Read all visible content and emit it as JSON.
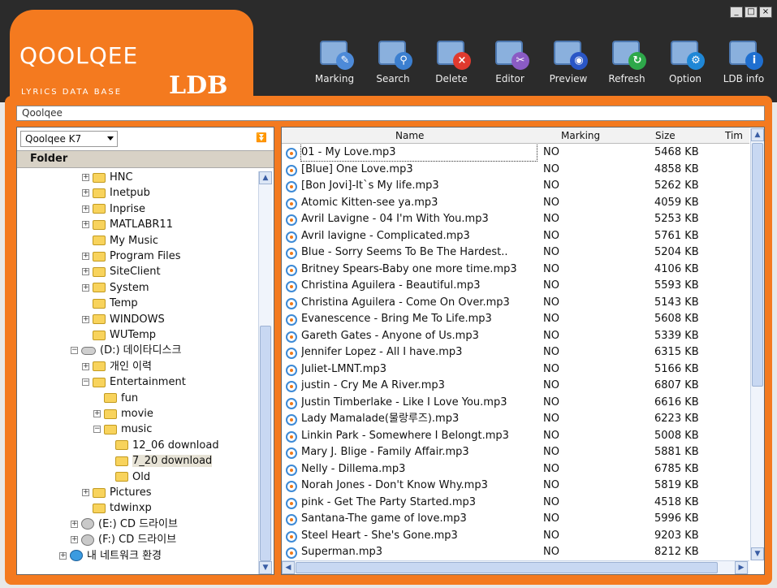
{
  "header": {
    "logo_text": "QOOLQEE",
    "logo_sub": "LYRICS DATA BASE",
    "logo_ldb": "LDB",
    "window_controls": {
      "minimize": "_",
      "maximize": "□",
      "close": "×"
    }
  },
  "toolbar": {
    "buttons": [
      {
        "label": "Marking",
        "icon": "pencil-book-icon",
        "badge": "✎",
        "badge_color": "#4d8ad8"
      },
      {
        "label": "Search",
        "icon": "magnifier-book-icon",
        "badge": "⚲",
        "badge_color": "#3b7fd0"
      },
      {
        "label": "Delete",
        "icon": "delete-book-icon",
        "badge": "×",
        "badge_color": "#e03a2e"
      },
      {
        "label": "Editor",
        "icon": "scissors-book-icon",
        "badge": "✂",
        "badge_color": "#8a5bc4"
      },
      {
        "label": "Preview",
        "icon": "eye-book-icon",
        "badge": "◉",
        "badge_color": "#2a56c6"
      },
      {
        "label": "Refresh",
        "icon": "refresh-book-icon",
        "badge": "↻",
        "badge_color": "#2ea84a"
      },
      {
        "label": "Option",
        "icon": "gear-book-icon",
        "badge": "⚙",
        "badge_color": "#1f87d6"
      },
      {
        "label": "LDB info",
        "icon": "info-icon",
        "badge": "i",
        "badge_color": "#1f6fd0"
      }
    ]
  },
  "pathbar": {
    "value": "Qoolqee"
  },
  "left_panel": {
    "combo_value": "Qoolqee K7",
    "folder_header": "Folder",
    "tree": [
      {
        "label": "HNC",
        "indent": 5,
        "expander": "+",
        "icon": "folder"
      },
      {
        "label": "Inetpub",
        "indent": 5,
        "expander": "+",
        "icon": "folder"
      },
      {
        "label": "Inprise",
        "indent": 5,
        "expander": "+",
        "icon": "folder"
      },
      {
        "label": "MATLABR11",
        "indent": 5,
        "expander": "+",
        "icon": "folder"
      },
      {
        "label": "My Music",
        "indent": 5,
        "expander": "",
        "icon": "folder"
      },
      {
        "label": "Program Files",
        "indent": 5,
        "expander": "+",
        "icon": "folder"
      },
      {
        "label": "SiteClient",
        "indent": 5,
        "expander": "+",
        "icon": "folder"
      },
      {
        "label": "System",
        "indent": 5,
        "expander": "+",
        "icon": "folder"
      },
      {
        "label": "Temp",
        "indent": 5,
        "expander": "",
        "icon": "folder"
      },
      {
        "label": "WINDOWS",
        "indent": 5,
        "expander": "+",
        "icon": "folder"
      },
      {
        "label": "WUTemp",
        "indent": 5,
        "expander": "",
        "icon": "folder"
      },
      {
        "label": "(D:) 데이타디스크",
        "indent": 4,
        "expander": "−",
        "icon": "drive"
      },
      {
        "label": "개인 이력",
        "indent": 5,
        "expander": "+",
        "icon": "folder"
      },
      {
        "label": "Entertainment",
        "indent": 5,
        "expander": "−",
        "icon": "folder"
      },
      {
        "label": "fun",
        "indent": 6,
        "expander": "",
        "icon": "folder"
      },
      {
        "label": "movie",
        "indent": 6,
        "expander": "+",
        "icon": "folder"
      },
      {
        "label": "music",
        "indent": 6,
        "expander": "−",
        "icon": "folder"
      },
      {
        "label": "12_06 download",
        "indent": 7,
        "expander": "",
        "icon": "folder"
      },
      {
        "label": "7_20 download",
        "indent": 7,
        "expander": "",
        "icon": "folder",
        "selected": true
      },
      {
        "label": "Old",
        "indent": 7,
        "expander": "",
        "icon": "folder"
      },
      {
        "label": "Pictures",
        "indent": 5,
        "expander": "+",
        "icon": "folder"
      },
      {
        "label": "tdwinxp",
        "indent": 5,
        "expander": "",
        "icon": "folder"
      },
      {
        "label": "(E:) CD 드라이브",
        "indent": 4,
        "expander": "+",
        "icon": "cd"
      },
      {
        "label": "(F:) CD 드라이브",
        "indent": 4,
        "expander": "+",
        "icon": "cd"
      },
      {
        "label": "내 네트워크 환경",
        "indent": 3,
        "expander": "+",
        "icon": "network"
      }
    ]
  },
  "file_list": {
    "columns": [
      "Name",
      "Marking",
      "Size",
      "Tim"
    ],
    "rows": [
      {
        "name": "01 - My Love.mp3",
        "marking": "NO",
        "size": "5468 KB"
      },
      {
        "name": "[Blue] One Love.mp3",
        "marking": "NO",
        "size": "4858 KB"
      },
      {
        "name": "[Bon Jovi]-It`s My life.mp3",
        "marking": "NO",
        "size": "5262 KB"
      },
      {
        "name": "Atomic Kitten-see ya.mp3",
        "marking": "NO",
        "size": "4059 KB"
      },
      {
        "name": "Avril Lavigne - 04 I'm With You.mp3",
        "marking": "NO",
        "size": "5253 KB"
      },
      {
        "name": "Avril lavigne - Complicated.mp3",
        "marking": "NO",
        "size": "5761 KB"
      },
      {
        "name": "Blue - Sorry Seems To Be The Hardest..",
        "marking": "NO",
        "size": "5204 KB"
      },
      {
        "name": "Britney Spears-Baby one more time.mp3",
        "marking": "NO",
        "size": "4106 KB"
      },
      {
        "name": "Christina Aguilera - Beautiful.mp3",
        "marking": "NO",
        "size": "5593 KB"
      },
      {
        "name": "Christina Aguilera - Come On Over.mp3",
        "marking": "NO",
        "size": "5143 KB"
      },
      {
        "name": "Evanescence - Bring Me To Life.mp3",
        "marking": "NO",
        "size": "5608 KB"
      },
      {
        "name": "Gareth Gates - Anyone of Us.mp3",
        "marking": "NO",
        "size": "5339 KB"
      },
      {
        "name": "Jennifer Lopez -  All I have.mp3",
        "marking": "NO",
        "size": "6315 KB"
      },
      {
        "name": "Juliet-LMNT.mp3",
        "marking": "NO",
        "size": "5166 KB"
      },
      {
        "name": "justin - Cry Me A River.mp3",
        "marking": "NO",
        "size": "6807 KB"
      },
      {
        "name": "Justin Timberlake - Like I Love You.mp3",
        "marking": "NO",
        "size": "6616 KB"
      },
      {
        "name": "Lady Mamalade(물랑루즈).mp3",
        "marking": "NO",
        "size": "6223 KB"
      },
      {
        "name": "Linkin Park - Somewhere I Belongt.mp3",
        "marking": "NO",
        "size": "5008 KB"
      },
      {
        "name": "Mary J. Blige - Family Affair.mp3",
        "marking": "NO",
        "size": "5881 KB"
      },
      {
        "name": "Nelly - Dillema.mp3",
        "marking": "NO",
        "size": "6785 KB"
      },
      {
        "name": "Norah Jones - Don't Know Why.mp3",
        "marking": "NO",
        "size": "5819 KB"
      },
      {
        "name": "pink - Get The Party Started.mp3",
        "marking": "NO",
        "size": "4518 KB"
      },
      {
        "name": "Santana-The game of love.mp3",
        "marking": "NO",
        "size": "5996 KB"
      },
      {
        "name": "Steel Heart - She's Gone.mp3",
        "marking": "NO",
        "size": "9203 KB"
      },
      {
        "name": "Superman.mp3",
        "marking": "NO",
        "size": "8212 KB"
      }
    ]
  },
  "colors": {
    "accent": "#f47a1f",
    "header_bg": "#2b2b2b"
  }
}
